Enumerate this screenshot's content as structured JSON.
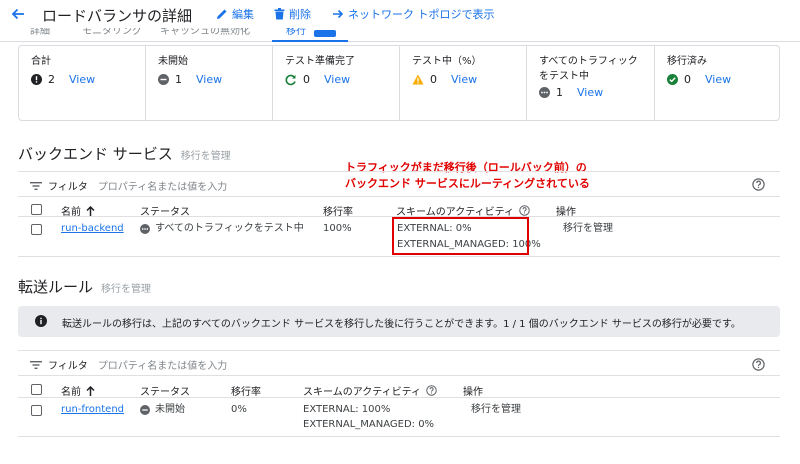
{
  "header": {
    "title": "ロードバランサの詳細",
    "edit_label": "編集",
    "delete_label": "削除",
    "topology_label": "ネットワーク トポロジで表示"
  },
  "tabs": [
    {
      "label": "詳細"
    },
    {
      "label": "モニタリング"
    },
    {
      "label": "キャッシュの無効化"
    },
    {
      "label": "移行"
    }
  ],
  "status_cards": [
    {
      "title": "合計",
      "icon": "error-icon",
      "count": "2",
      "link": "View"
    },
    {
      "title": "未開始",
      "icon": "minus-circle-icon",
      "count": "1",
      "link": "View"
    },
    {
      "title": "テスト準備完了",
      "icon": "refresh-icon",
      "count": "0",
      "link": "View"
    },
    {
      "title": "テスト中（%）",
      "icon": "warning-icon",
      "count": "0",
      "link": "View"
    },
    {
      "title": "すべてのトラフィックをテスト中",
      "icon": "pending-icon",
      "count": "1",
      "link": "View"
    },
    {
      "title": "移行済み",
      "icon": "check-circle-icon",
      "count": "0",
      "link": "View"
    }
  ],
  "annotation": {
    "line1": "トラフィックがまだ移行後（ロールバック前）の",
    "line2": "バックエンド サービスにルーティングされている"
  },
  "backend_section": {
    "title": "バックエンド サービス",
    "manage_link": "移行を管理",
    "filter_label": "フィルタ",
    "filter_placeholder": "プロパティ名または値を入力",
    "columns": [
      "名前",
      "ステータス",
      "移行率",
      "スキームのアクティビティ",
      "操作"
    ],
    "rows": [
      {
        "name": "run-backend",
        "status": "すべてのトラフィックをテスト中",
        "rate": "100%",
        "scheme1": "EXTERNAL: 0%",
        "scheme2": "EXTERNAL_MANAGED: 100%",
        "action": "移行を管理"
      }
    ]
  },
  "forwarding_section": {
    "title": "転送ルール",
    "manage_link": "移行を管理",
    "info": "転送ルールの移行は、上記のすべてのバックエンド サービスを移行した後に行うことができます。1 / 1 個のバックエンド サービスの移行が必要です。",
    "filter_label": "フィルタ",
    "filter_placeholder": "プロパティ名または値を入力",
    "columns": [
      "名前",
      "ステータス",
      "移行率",
      "スキームのアクティビティ",
      "操作"
    ],
    "rows": [
      {
        "name": "run-frontend",
        "status": "未開始",
        "rate": "0%",
        "scheme1": "EXTERNAL: 100%",
        "scheme2": "EXTERNAL_MANAGED: 0%",
        "action": "移行を管理"
      }
    ]
  },
  "colors": {
    "accent": "#1a73e8",
    "annotation": "#e00000",
    "success": "#188038",
    "warning": "#f9ab00"
  }
}
